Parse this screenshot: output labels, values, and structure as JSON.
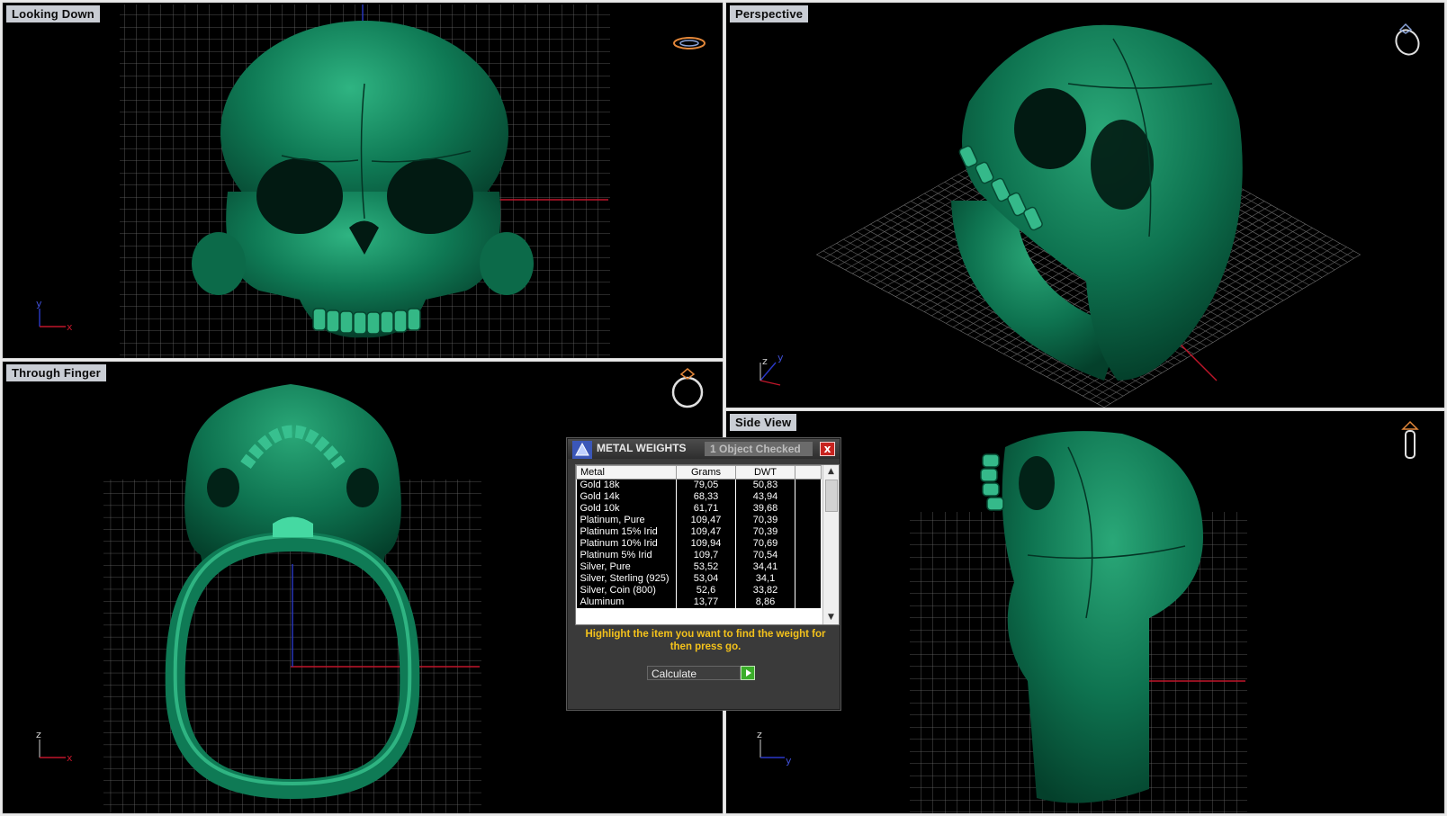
{
  "viewports": {
    "top_left": {
      "label": "Looking Down",
      "axis_h": "x",
      "axis_v": "y"
    },
    "top_right": {
      "label": "Perspective",
      "axis_h": "y",
      "axis_v": "z"
    },
    "bottom_left": {
      "label": "Through Finger",
      "axis_h": "x",
      "axis_v": "z"
    },
    "bottom_right": {
      "label": "Side View",
      "axis_h": "y",
      "axis_v": "z"
    }
  },
  "colors": {
    "model": "#0f7a55",
    "background": "#000000",
    "grid": "#6a6a6a",
    "axis_x": "#c0162a",
    "axis_y": "#2a39c8",
    "dialog_hint": "#f4c21b"
  },
  "icons": {
    "view_icon_top_left": "ring-top-icon",
    "view_icon_top_right": "ring-perspective-icon",
    "view_icon_bottom_left": "ring-front-icon",
    "view_icon_bottom_right": "ring-side-icon"
  },
  "dialog": {
    "title": "METAL WEIGHTS",
    "subtitle": "1 Object Checked",
    "close": "x",
    "columns": [
      "Metal",
      "Grams",
      "DWT"
    ],
    "rows": [
      [
        "Gold 18k",
        "79,05",
        "50,83"
      ],
      [
        "Gold 14k",
        "68,33",
        "43,94"
      ],
      [
        "Gold 10k",
        "61,71",
        "39,68"
      ],
      [
        "Platinum, Pure",
        "109,47",
        "70,39"
      ],
      [
        "Platinum 15% Irid",
        "109,47",
        "70,39"
      ],
      [
        "Platinum 10% Irid",
        "109,94",
        "70,69"
      ],
      [
        "Platinum 5% Irid",
        "109,7",
        "70,54"
      ],
      [
        "Silver, Pure",
        "53,52",
        "34,41"
      ],
      [
        "Silver, Sterling (925)",
        "53,04",
        "34,1"
      ],
      [
        "Silver, Coin (800)",
        "52,6",
        "33,82"
      ],
      [
        "Aluminum",
        "13,77",
        "8,86"
      ]
    ],
    "hint": "Highlight the item you want to find the weight for then press go.",
    "calculate_label": "Calculate"
  }
}
